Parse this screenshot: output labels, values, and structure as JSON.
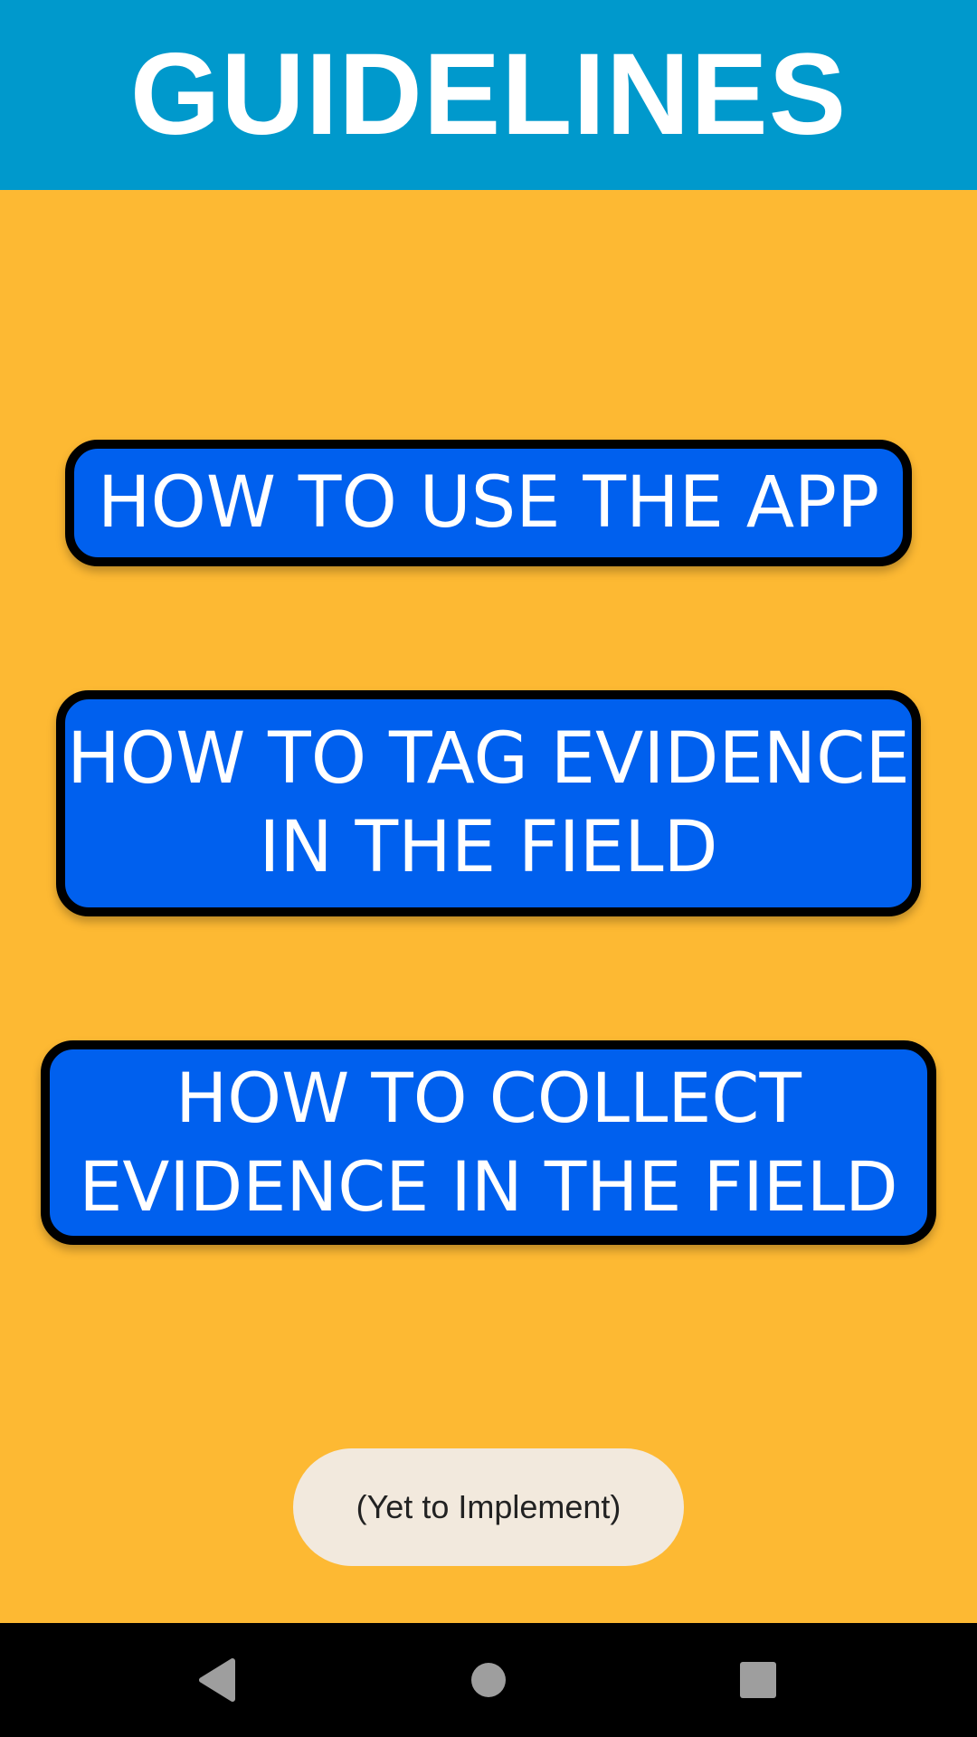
{
  "header": {
    "title": "GUIDELINES"
  },
  "buttons": [
    {
      "label": "HOW TO USE THE APP"
    },
    {
      "label": "HOW TO TAG EVIDENCE\nIN THE FIELD"
    },
    {
      "label": "HOW TO COLLECT\nEVIDENCE IN THE FIELD"
    }
  ],
  "toast": {
    "text": "(Yet to Implement)"
  },
  "navbar": {
    "back_icon": "back-triangle-icon",
    "home_icon": "home-circle-icon",
    "recents_icon": "recents-square-icon"
  },
  "colors": {
    "header_bg": "#0099CC",
    "page_bg": "#FDB933",
    "button_bg": "#0060EE",
    "button_border": "#000000",
    "toast_bg": "#F2E9DD",
    "navbar_bg": "#000000"
  }
}
